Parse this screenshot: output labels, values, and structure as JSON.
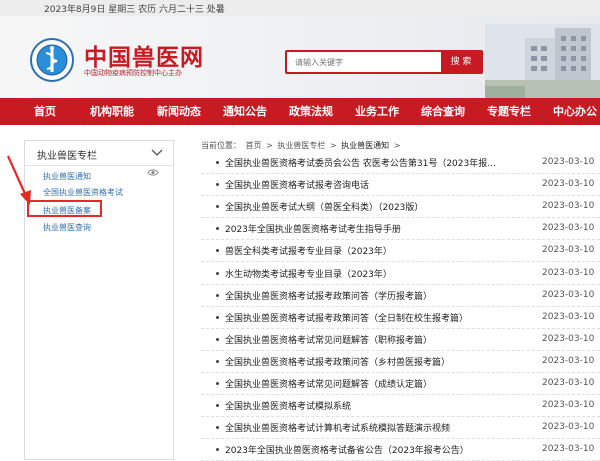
{
  "topbar": {
    "date_text": "2023年8月9日 星期三 农历 六月二十三 处暑"
  },
  "header": {
    "logo_title": "中国兽医网",
    "logo_subtitle": "中国动物疫病预防控制中心主办",
    "search_placeholder": "请输入关键字",
    "search_button": "搜 索",
    "brand_color": "#c81a22"
  },
  "nav": {
    "items": [
      "首页",
      "机构职能",
      "新闻动态",
      "通知公告",
      "政策法规",
      "业务工作",
      "综合查询",
      "专题专栏",
      "中心办公"
    ]
  },
  "sidebar": {
    "title": "执业兽医专栏",
    "links": [
      "执业兽医通知",
      "全国执业兽医资格考试",
      "执业兽医备案",
      "执业兽医查询"
    ],
    "highlighted": "执业兽医备案",
    "highlight_color": "#e32a26"
  },
  "breadcrumb": {
    "label": "当前位置：",
    "items": [
      "首页",
      ">",
      "执业兽医专栏",
      ">",
      "执业兽医通知",
      ">"
    ]
  },
  "list": {
    "items": [
      {
        "title": "全国执业兽医资格考试委员会公告 农医考公告第31号（2023年报...",
        "date": "2023-03-10"
      },
      {
        "title": "全国执业兽医资格考试报考咨询电话",
        "date": "2023-03-10"
      },
      {
        "title": "全国执业兽医考试大纲（兽医全科类）（2023版）",
        "date": "2023-03-10"
      },
      {
        "title": "2023年全国执业兽医资格考试考生指导手册",
        "date": "2023-03-10"
      },
      {
        "title": "兽医全科类考试报考专业目录（2023年）",
        "date": "2023-03-10"
      },
      {
        "title": "水生动物类考试报考专业目录（2023年）",
        "date": "2023-03-10"
      },
      {
        "title": "全国执业兽医资格考试报考政策问答（学历报考篇）",
        "date": "2023-03-10"
      },
      {
        "title": "全国执业兽医资格考试报考政策问答（全日制在校生报考篇）",
        "date": "2023-03-10"
      },
      {
        "title": "全国执业兽医资格考试常见问题解答（职称报考篇）",
        "date": "2023-03-10"
      },
      {
        "title": "全国执业兽医资格考试报考政策问答（乡村兽医报考篇）",
        "date": "2023-03-10"
      },
      {
        "title": "全国执业兽医资格考试常见问题解答（成绩认定篇）",
        "date": "2023-03-10"
      },
      {
        "title": "全国执业兽医资格考试模拟系统",
        "date": "2023-03-10"
      },
      {
        "title": "全国执业兽医资格考试计算机考试系统模拟答题演示视频",
        "date": "2023-03-10"
      },
      {
        "title": "2023年全国执业兽医资格考试备省公告（2023年报考公告）",
        "date": "2023-03-10"
      }
    ]
  }
}
